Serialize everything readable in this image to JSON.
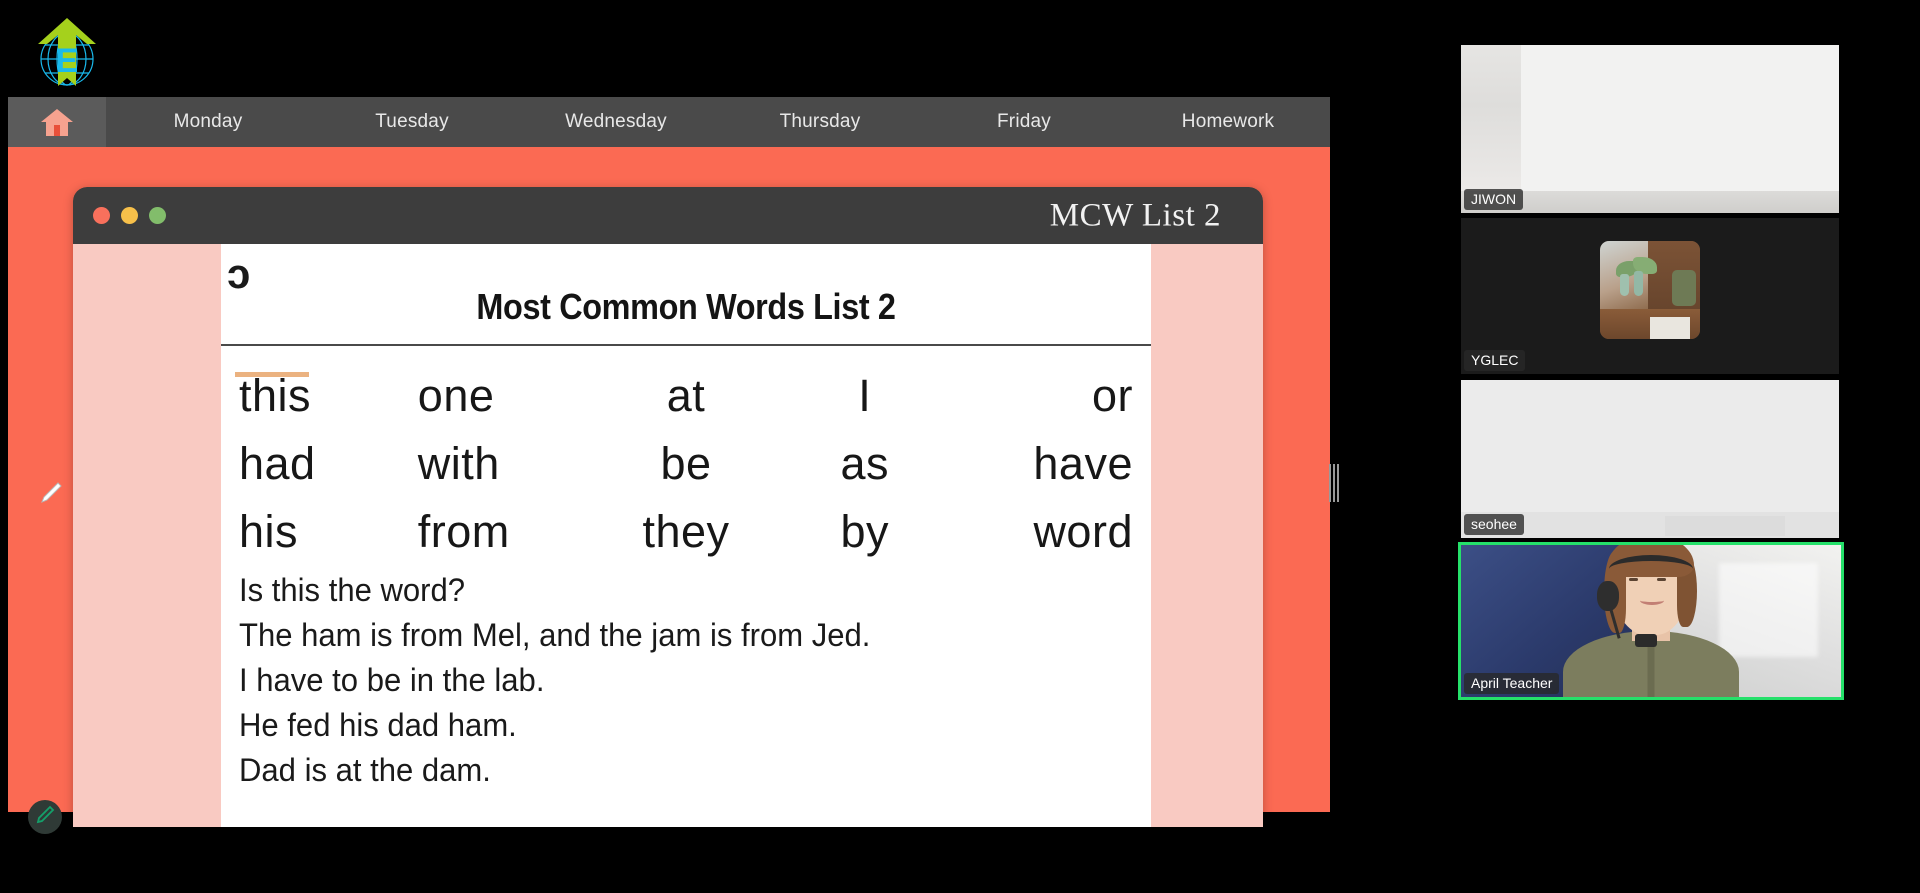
{
  "app": {
    "logo_name": "eagle-globe-logo",
    "home_tab_icon": "home-icon"
  },
  "nav": {
    "items": [
      {
        "label": "Monday"
      },
      {
        "label": "Tuesday"
      },
      {
        "label": "Wednesday"
      },
      {
        "label": "Thursday"
      },
      {
        "label": "Friday"
      },
      {
        "label": "Homework"
      }
    ]
  },
  "slide": {
    "title": "MCW List 2",
    "traffic_lights": [
      "close",
      "minimize",
      "maximize"
    ],
    "colors": {
      "page_background": "#fb6a53",
      "titlebar": "#3d3d3d",
      "worksheet_frame": "#f9cac2",
      "paper": "#ffffff"
    }
  },
  "worksheet": {
    "stray_glyph": "ɔ",
    "heading": "Most Common Words List 2",
    "word_rows": [
      [
        "this",
        "one",
        "at",
        "I",
        "or"
      ],
      [
        "had",
        "with",
        "be",
        "as",
        "have"
      ],
      [
        "his",
        "from",
        "they",
        "by",
        "word"
      ]
    ],
    "sentences": [
      "Is this the word?",
      "The ham is from Mel, and the jam is from Jed.",
      "I have to be in the lab.",
      "He fed his dad ham.",
      "Dad is at the dam."
    ]
  },
  "tools": {
    "pencil_cursor": "pencil-cursor-icon",
    "pen_button": "pen-tool-icon",
    "drag_handle": "resize-grip-handle"
  },
  "video": {
    "participants": [
      {
        "name": "JIWON",
        "active_speaker": false
      },
      {
        "name": "YGLEC",
        "active_speaker": false
      },
      {
        "name": "seohee",
        "active_speaker": false
      },
      {
        "name": "April Teacher",
        "active_speaker": true
      }
    ],
    "active_speaker_color": "#25e06a"
  }
}
